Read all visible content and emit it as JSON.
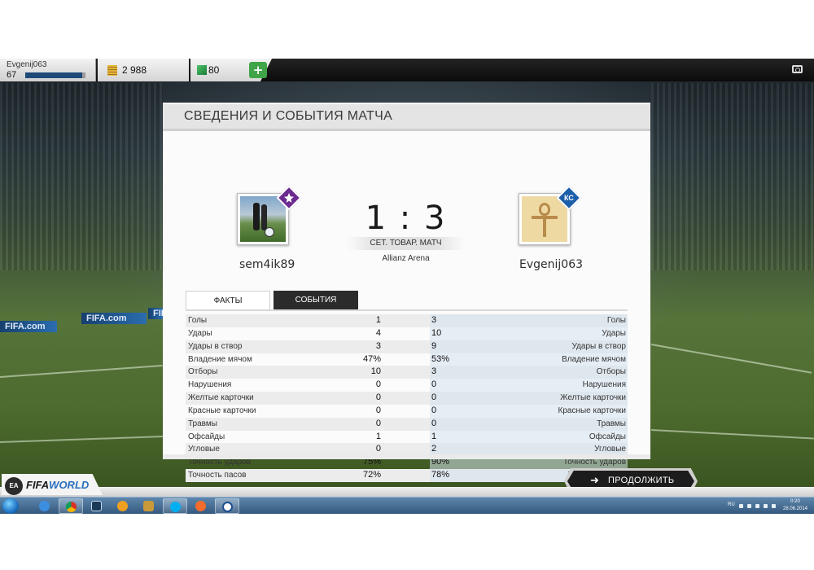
{
  "topbar": {
    "player_name": "Evgenij063",
    "player_level": "67",
    "xp_progress": 0.95,
    "coins": "2 988",
    "points": "80",
    "add_label": "+"
  },
  "panel": {
    "title": "СВЕДЕНИЯ И СОБЫТИЯ МАТЧА",
    "home_team": "sem4ik89",
    "away_team": "Evgenij063",
    "score": "1 : 3",
    "match_type": "СЕТ. ТОВАР. МАТЧ",
    "venue": "Allianz Arena",
    "tabs": [
      {
        "label": "ФАКТЫ",
        "active": true
      },
      {
        "label": "СОБЫТИЯ",
        "active": false
      }
    ],
    "stats": [
      {
        "name": "Голы",
        "home": "1",
        "away": "3"
      },
      {
        "name": "Удары",
        "home": "4",
        "away": "10"
      },
      {
        "name": "Удары в створ",
        "home": "3",
        "away": "9"
      },
      {
        "name": "Владение мячом",
        "home": "47%",
        "away": "53%"
      },
      {
        "name": "Отборы",
        "home": "10",
        "away": "3"
      },
      {
        "name": "Нарушения",
        "home": "0",
        "away": "0"
      },
      {
        "name": "Желтые карточки",
        "home": "0",
        "away": "0"
      },
      {
        "name": "Красные карточки",
        "home": "0",
        "away": "0"
      },
      {
        "name": "Травмы",
        "home": "0",
        "away": "0"
      },
      {
        "name": "Офсайды",
        "home": "1",
        "away": "1"
      },
      {
        "name": "Угловые",
        "home": "0",
        "away": "2"
      },
      {
        "name": "Точность ударов",
        "home": "75%",
        "away": "90%"
      },
      {
        "name": "Точность пасов",
        "home": "72%",
        "away": "78%"
      }
    ]
  },
  "continue_button": {
    "label": "ПРОДОЛЖИТЬ",
    "arrow": "➜"
  },
  "branding": {
    "ea": "EA",
    "fifa": "FIFA",
    "world": "WORLD"
  },
  "stadium_boards": [
    "FIFA.com",
    "FIFA.com",
    "FIFA"
  ],
  "crest_right_text": "КС",
  "taskbar": {
    "items": [
      "ie-icon",
      "chrome-icon",
      "terminal-icon",
      "media-player-icon",
      "game-icon",
      "skype-icon",
      "origin-icon",
      "fifa-world-icon"
    ],
    "language": "RU",
    "time": "0:20",
    "date": "28.06.2014"
  },
  "colors": {
    "accent_green": "#3fa548",
    "xp_blue": "#1e4a7a",
    "panel_bg": "#fbfbfb",
    "continue_bg": "#1c1c1c"
  }
}
